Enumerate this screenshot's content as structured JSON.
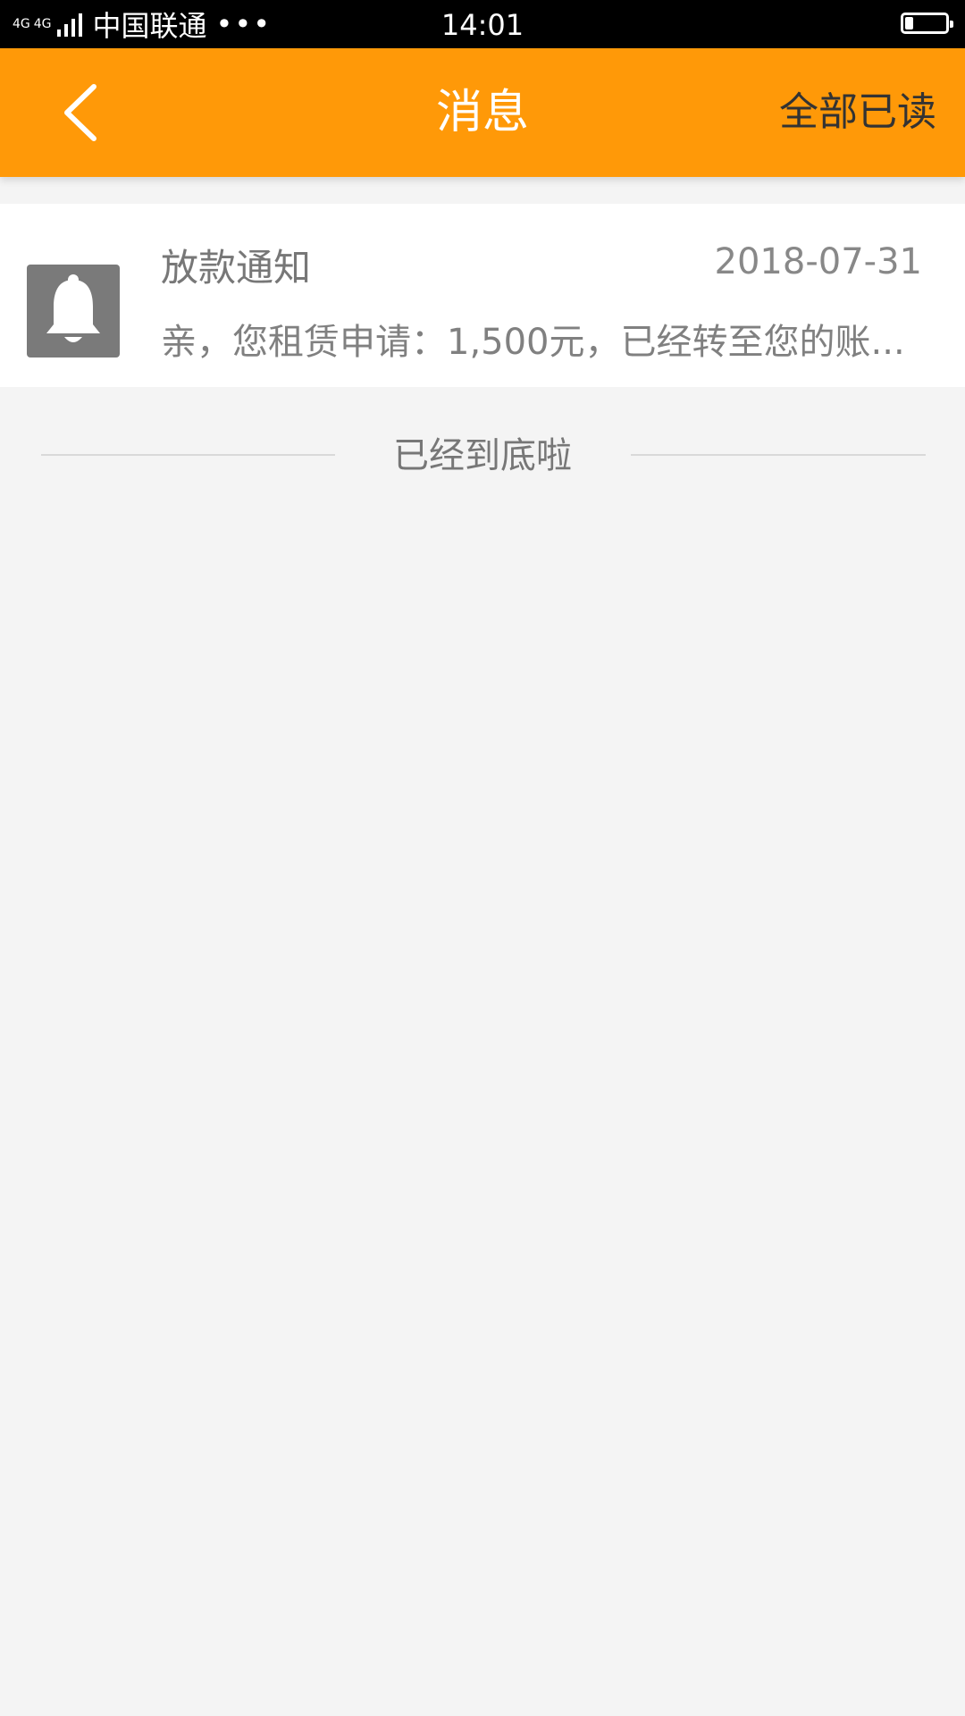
{
  "status_bar": {
    "network_badge": "4G",
    "network_badge_2": "4G",
    "carrier": "中国联通",
    "more": "•••",
    "time": "14:01",
    "battery_level": 0.2
  },
  "header": {
    "title": "消息",
    "mark_all_read": "全部已读",
    "back_icon": "chevron-left-icon",
    "background_color": "#ff9908"
  },
  "messages": [
    {
      "icon": "bell-icon",
      "title": "放款通知",
      "date": "2018-07-31",
      "preview": "亲，您租赁申请：1,500元，已经转至您的账..."
    }
  ],
  "footer": {
    "end_text": "已经到底啦"
  }
}
